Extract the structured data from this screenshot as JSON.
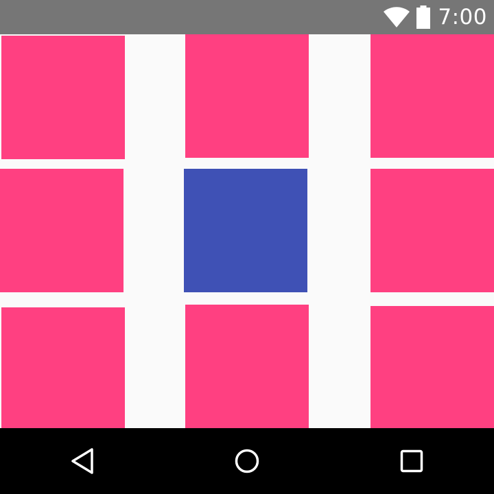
{
  "status_bar": {
    "time": "7:00",
    "icons": [
      "wifi-icon",
      "battery-icon"
    ],
    "background": "#767676"
  },
  "grid": {
    "background": "#fafafa",
    "tiles": [
      {
        "name": "tile-top-left",
        "color": "#ff4081"
      },
      {
        "name": "tile-top-center",
        "color": "#ff4081"
      },
      {
        "name": "tile-top-right",
        "color": "#ff4081"
      },
      {
        "name": "tile-middle-left",
        "color": "#ff4081"
      },
      {
        "name": "tile-center",
        "color": "#3f51b5"
      },
      {
        "name": "tile-middle-right",
        "color": "#ff4081"
      },
      {
        "name": "tile-bottom-left",
        "color": "#ff4081"
      },
      {
        "name": "tile-bottom-center",
        "color": "#ff4081"
      },
      {
        "name": "tile-bottom-right",
        "color": "#ff4081"
      }
    ]
  },
  "nav_bar": {
    "background": "#000000",
    "buttons": [
      "back-icon",
      "home-icon",
      "recents-icon"
    ]
  }
}
